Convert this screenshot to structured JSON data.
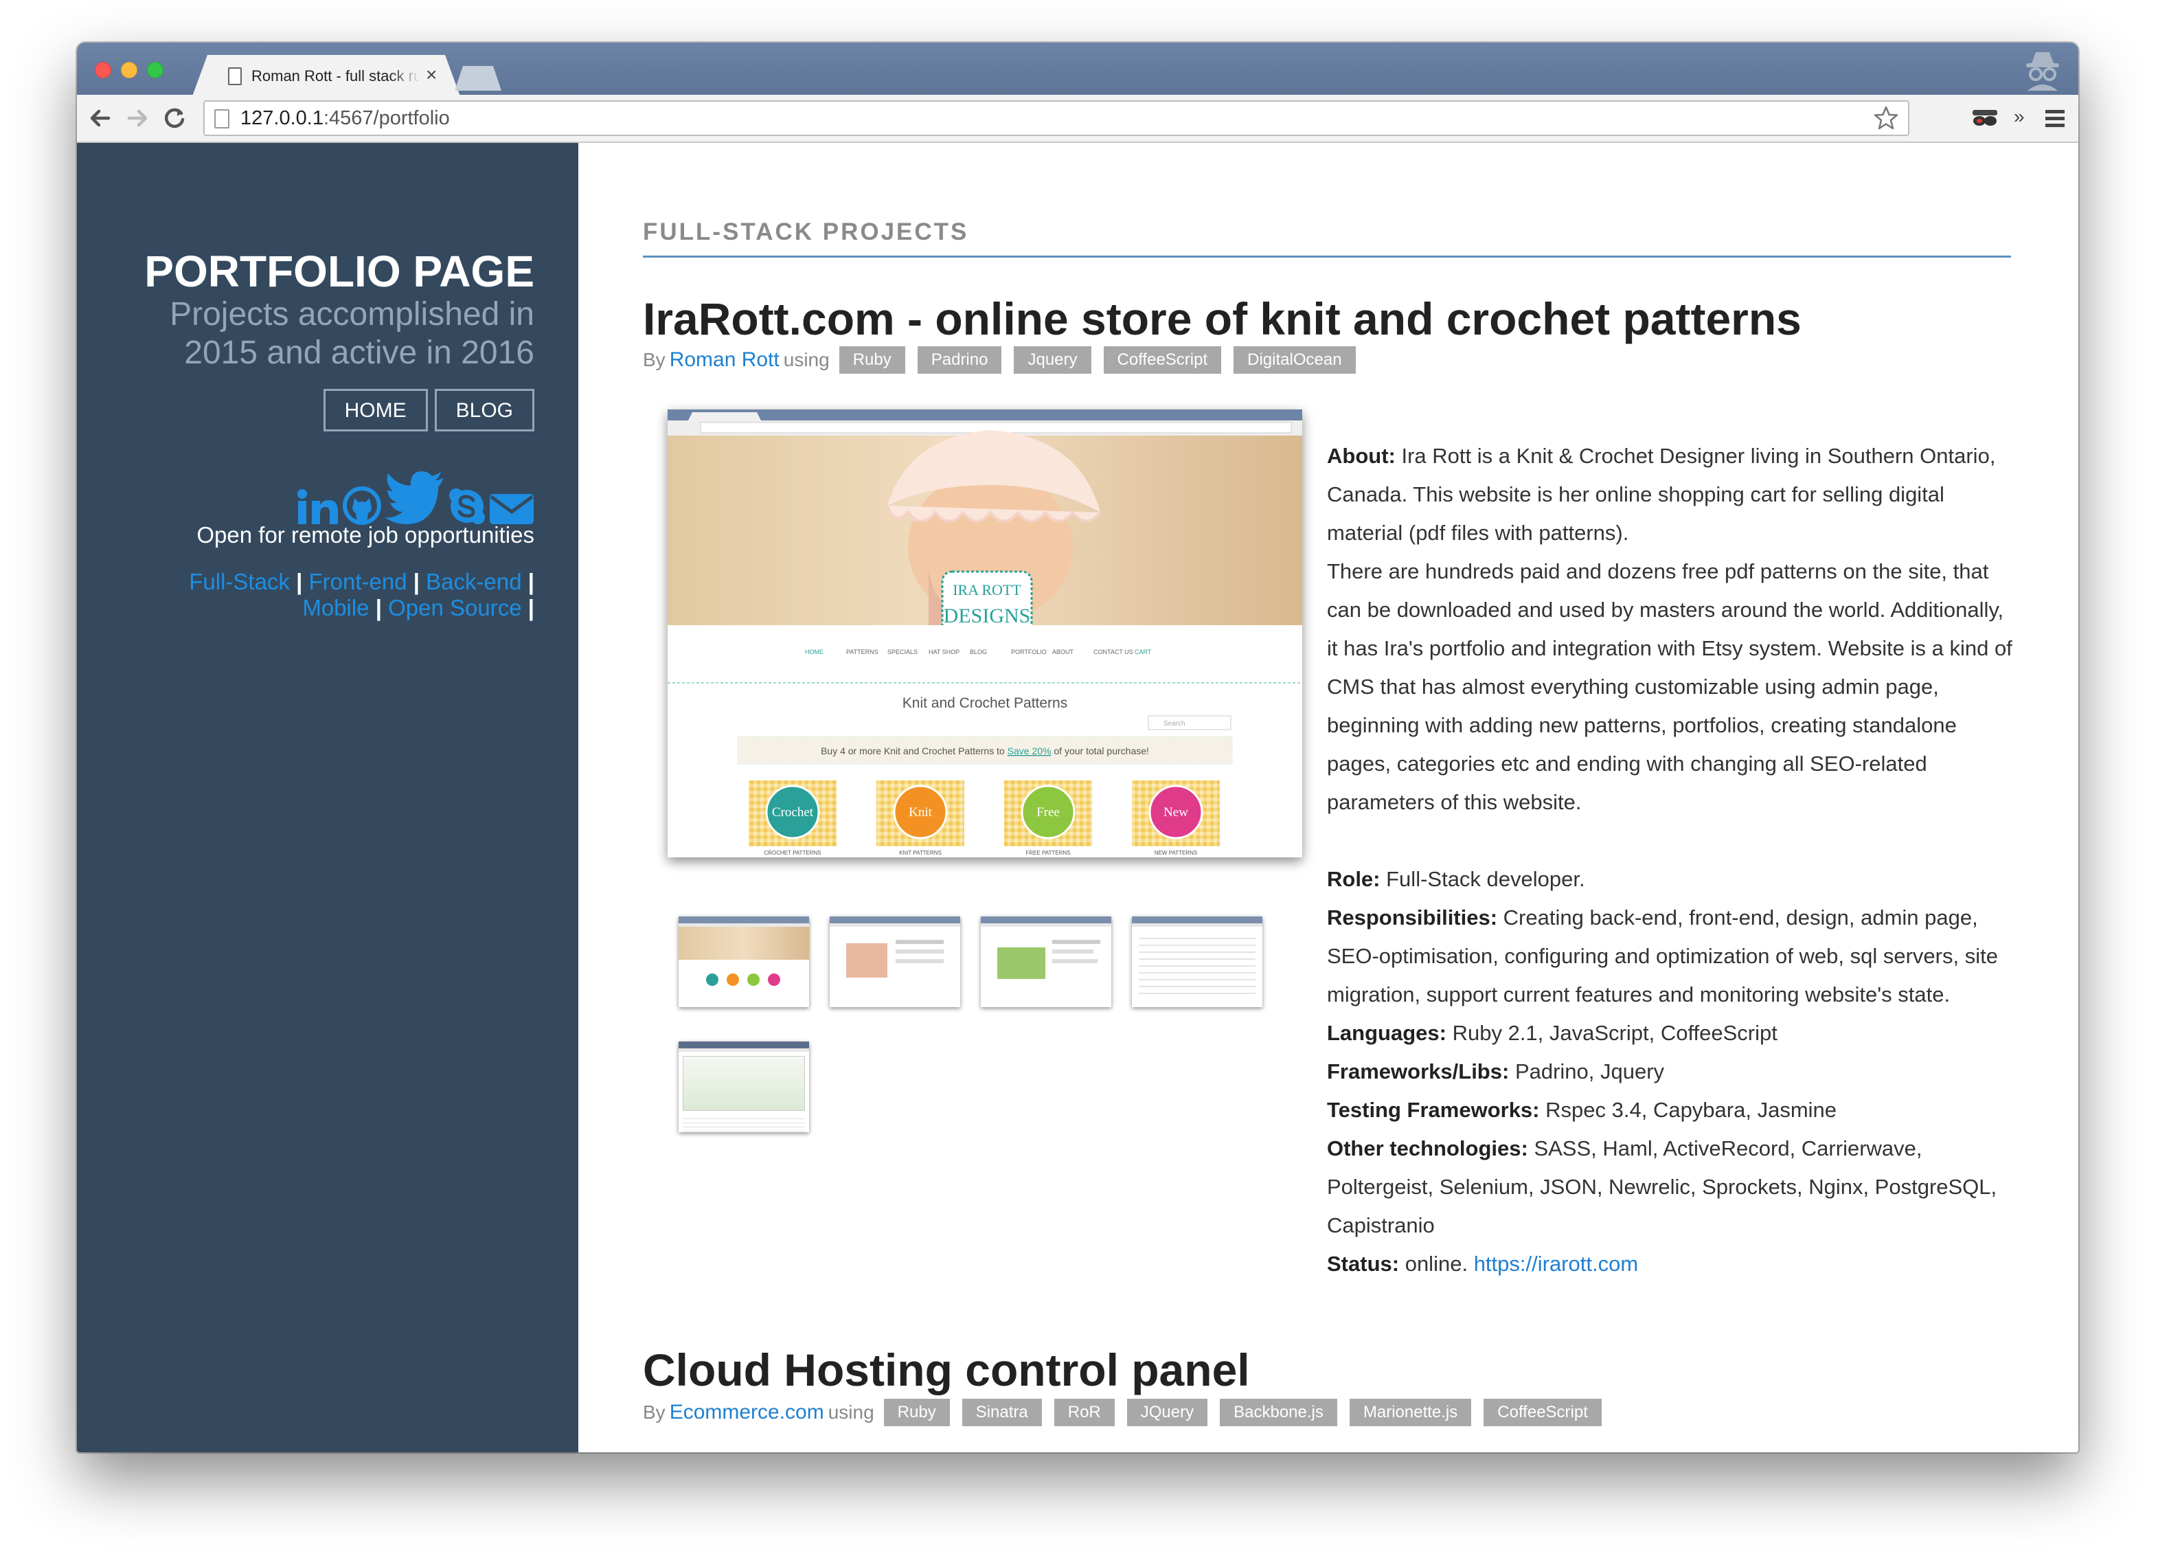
{
  "browser": {
    "tab_title": "Roman Rott - full stack ruby developer",
    "tab_close": "×",
    "url_host": "127.0.0.1",
    "url_rest": ":4567/portfolio",
    "overflow_label": "»"
  },
  "sidebar": {
    "title": "PORTFOLIO PAGE",
    "subtitle": "Projects accomplished in 2015 and active in 2016",
    "nav": [
      {
        "label": "HOME"
      },
      {
        "label": "BLOG"
      }
    ],
    "social_icons": [
      "linkedin-icon",
      "github-icon",
      "twitter-icon",
      "skype-icon",
      "mail-icon"
    ],
    "job_text": "Open for remote job opportunities",
    "skills": [
      "Full-Stack",
      "Front-end",
      "Back-end",
      "Mobile",
      "Open Source"
    ],
    "separator": "|",
    "accent_color": "#1e8ee2",
    "background_color": "#34495e"
  },
  "main": {
    "section_heading": "FULL-STACK PROJECTS",
    "projects": [
      {
        "title": "IraRott.com - online store of knit and crochet patterns",
        "by_label": "By",
        "author": "Roman Rott",
        "using_label": "using",
        "tags": [
          "Ruby",
          "Padrino",
          "Jquery",
          "CoffeeScript",
          "DigitalOcean"
        ],
        "screenshot": {
          "page_heading": "Knit and Crochet Patterns",
          "logo_text": "DESIGNS",
          "logo_top": "IRA ROTT",
          "menu": [
            "HOME",
            "PATTERNS",
            "SPECIALS",
            "HAT SHOP",
            "BLOG",
            "PORTFOLIO",
            "ABOUT",
            "CONTACT US",
            "CART"
          ],
          "search_placeholder": "Search",
          "promo_before": "Buy 4 or more Knit and Crochet Patterns to",
          "promo_link": "Save 20%",
          "promo_after": "of your total purchase!",
          "categories": [
            {
              "name": "Crochet",
              "caption": "CROCHET PATTERNS",
              "color": "#2aa198"
            },
            {
              "name": "Knit",
              "caption": "KNIT PATTERNS",
              "color": "#f39223"
            },
            {
              "name": "Free",
              "caption": "FREE PATTERNS",
              "color": "#8dc63f"
            },
            {
              "name": "New",
              "caption": "NEW PATTERNS",
              "color": "#e03b8b"
            }
          ]
        },
        "thumbnail_count": 5,
        "about_label": "About:",
        "about_text": "Ira Rott is a Knit & Crochet Designer living in Southern Ontario, Canada. This website is her online shopping cart for selling digital material (pdf files with patterns).",
        "about_text_2": "There are hundreds paid and dozens free pdf patterns on the site, that can be downloaded and used by masters around the world. Additionally, it has Ira's portfolio and integration with Etsy system. Website is a kind of CMS that has almost everything customizable using admin page, beginning with adding new patterns, portfolios, creating standalone pages, categories etc and ending with changing all SEO-related parameters of this website.",
        "details": [
          {
            "label": "Role:",
            "value": "Full-Stack developer."
          },
          {
            "label": "Responsibilities:",
            "value": "Creating back-end, front-end, design, admin page, SEO-optimisation, configuring and optimization of web, sql servers, site migration, support current features and monitoring website's state."
          },
          {
            "label": "Languages:",
            "value": "Ruby 2.1, JavaScript, CoffeeScript"
          },
          {
            "label": "Frameworks/Libs:",
            "value": "Padrino, Jquery"
          },
          {
            "label": "Testing Frameworks:",
            "value": "Rspec 3.4, Capybara, Jasmine"
          },
          {
            "label": "Other technologies:",
            "value": "SASS, Haml, ActiveRecord, Carrierwave, Poltergeist, Selenium, JSON, Newrelic, Sprockets, Nginx, PostgreSQL, Capistranio"
          }
        ],
        "status_label": "Status:",
        "status_value": "online.",
        "status_link": "https://irarott.com"
      },
      {
        "title": "Cloud Hosting control panel",
        "by_label": "By",
        "author": "Ecommerce.com",
        "using_label": "using",
        "tags": [
          "Ruby",
          "Sinatra",
          "RoR",
          "JQuery",
          "Backbone.js",
          "Marionette.js",
          "CoffeeScript"
        ]
      }
    ]
  }
}
